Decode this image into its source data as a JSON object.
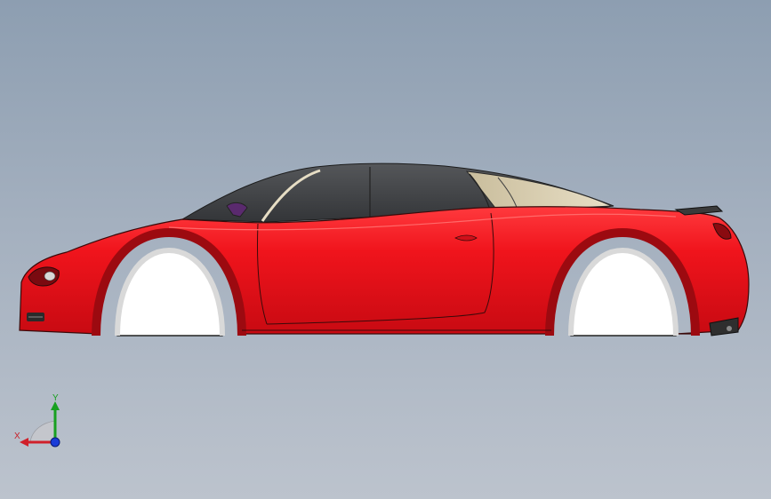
{
  "viewport": {
    "background_top": "#8d9eb1",
    "background_bottom": "#bcc3cd"
  },
  "model": {
    "name": "car-body-side-view",
    "body_color": "#f0141c",
    "glass_color": "#3d3f42",
    "rear_glass_color": "#d9ccaa",
    "wheel_well_color": "#ffffff"
  },
  "triad": {
    "x_label": "X",
    "y_label": "Y",
    "x_color": "#d0202a",
    "y_color": "#18a020",
    "z_color": "#1a3cd8"
  }
}
